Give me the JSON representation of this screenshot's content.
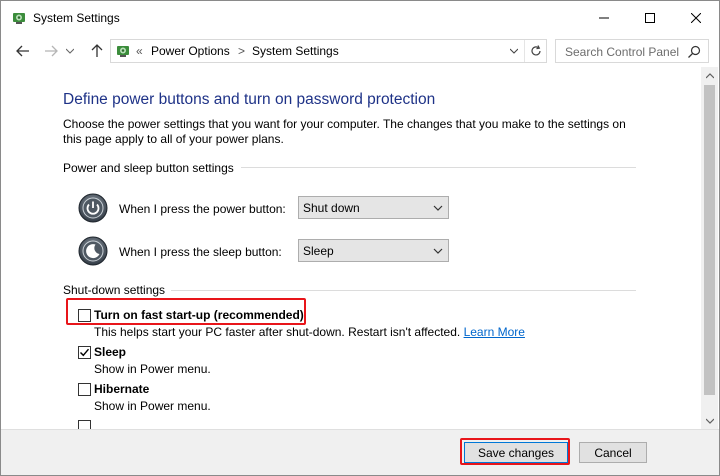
{
  "window": {
    "title": "System Settings",
    "controls": [
      "minimize",
      "maximize",
      "close"
    ]
  },
  "addressbar": {
    "crumb_separator": "«",
    "crumbs": [
      "Power Options",
      "System Settings"
    ],
    "crumb_arrow": ">"
  },
  "search": {
    "placeholder": "Search Control Panel"
  },
  "main": {
    "heading": "Define power buttons and turn on password protection",
    "intro": "Choose the power settings that you want for your computer. The changes that you make to the settings on this page apply to all of your power plans.",
    "power_group": {
      "label": "Power and sleep button settings",
      "rows": [
        {
          "label": "When I press the power button:",
          "value": "Shut down",
          "icon": "power-button-icon"
        },
        {
          "label": "When I press the sleep button:",
          "value": "Sleep",
          "icon": "sleep-button-icon"
        }
      ]
    },
    "shutdown_group": {
      "label": "Shut-down settings",
      "items": [
        {
          "label": "Turn on fast start-up (recommended)",
          "checked": false,
          "desc": "This helps start your PC faster after shut-down. Restart isn't affected. ",
          "link": "Learn More"
        },
        {
          "label": "Sleep",
          "checked": true,
          "desc": "Show in Power menu."
        },
        {
          "label": "Hibernate",
          "checked": false,
          "desc": "Show in Power menu."
        }
      ]
    }
  },
  "footer": {
    "save_label": "Save changes",
    "cancel_label": "Cancel"
  },
  "colors": {
    "heading": "#1e3287",
    "highlight": "#e8151a",
    "link": "#0066cc"
  }
}
